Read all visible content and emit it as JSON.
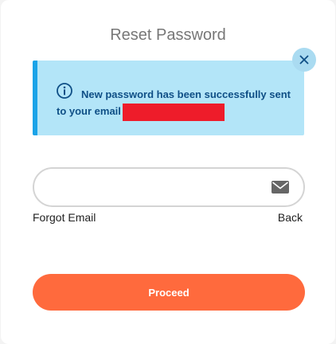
{
  "page": {
    "title": "Reset Password"
  },
  "alert": {
    "message": "New password has been successfully sent to your email",
    "info_icon": "info-circle-icon",
    "close_icon": "close-icon",
    "colors": {
      "background": "#b3e5f8",
      "accent": "#1aa3e8",
      "text": "#0f4f86",
      "redaction": "#ee1c2a"
    }
  },
  "email_field": {
    "value": "",
    "placeholder": "",
    "icon": "envelope-icon"
  },
  "links": {
    "forgot_email": "Forgot Email",
    "back": "Back"
  },
  "actions": {
    "proceed_label": "Proceed",
    "proceed_color": "#ff6a3d"
  }
}
